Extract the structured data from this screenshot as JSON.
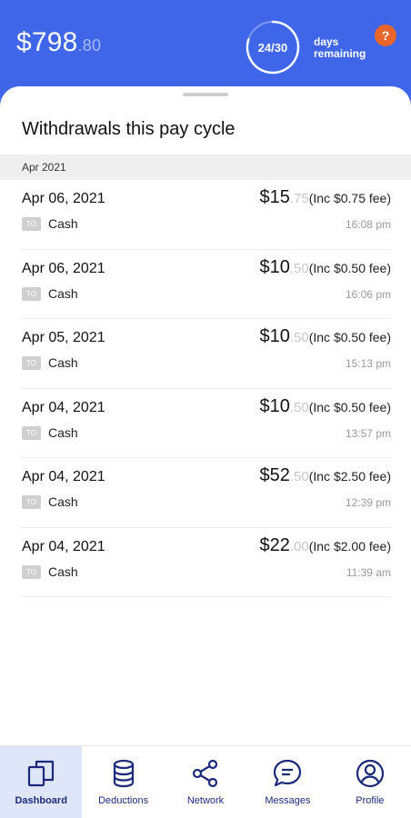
{
  "header": {
    "balance_dollars": "$798",
    "balance_cents": ".80",
    "days_progress": "24/30",
    "days_done": 24,
    "days_total": 30,
    "days_label_line1": "days",
    "days_label_line2": "remaining",
    "help_label": "?",
    "colors": {
      "background": "#3f66e8",
      "help": "#e8652b"
    }
  },
  "sheet": {
    "title": "Withdrawals this pay cycle",
    "month": "Apr 2021"
  },
  "withdrawals": [
    {
      "date": "Apr 06, 2021",
      "badge": "TO",
      "method": "Cash",
      "dollars": "$15",
      "cents": ".75",
      "fee": "(Inc $0.75 fee)",
      "time": "16:08 pm"
    },
    {
      "date": "Apr 06, 2021",
      "badge": "TO",
      "method": "Cash",
      "dollars": "$10",
      "cents": ".50",
      "fee": "(Inc $0.50 fee)",
      "time": "16:06 pm"
    },
    {
      "date": "Apr 05, 2021",
      "badge": "TO",
      "method": "Cash",
      "dollars": "$10",
      "cents": ".50",
      "fee": "(Inc $0.50 fee)",
      "time": "15:13 pm"
    },
    {
      "date": "Apr 04, 2021",
      "badge": "TO",
      "method": "Cash",
      "dollars": "$10",
      "cents": ".50",
      "fee": "(Inc $0.50 fee)",
      "time": "13:57 pm"
    },
    {
      "date": "Apr 04, 2021",
      "badge": "TO",
      "method": "Cash",
      "dollars": "$52",
      "cents": ".50",
      "fee": "(Inc $2.50 fee)",
      "time": "12:39 pm"
    },
    {
      "date": "Apr 04, 2021",
      "badge": "TO",
      "method": "Cash",
      "dollars": "$22",
      "cents": ".00",
      "fee": "(Inc $2.00 fee)",
      "time": "11:39 am"
    }
  ],
  "tabs": [
    {
      "label": "Dashboard",
      "icon": "dashboard-icon",
      "active": true
    },
    {
      "label": "Deductions",
      "icon": "database-icon",
      "active": false
    },
    {
      "label": "Network",
      "icon": "share-icon",
      "active": false
    },
    {
      "label": "Messages",
      "icon": "chat-bubble-icon",
      "active": false
    },
    {
      "label": "Profile",
      "icon": "user-circle-icon",
      "active": false
    }
  ]
}
